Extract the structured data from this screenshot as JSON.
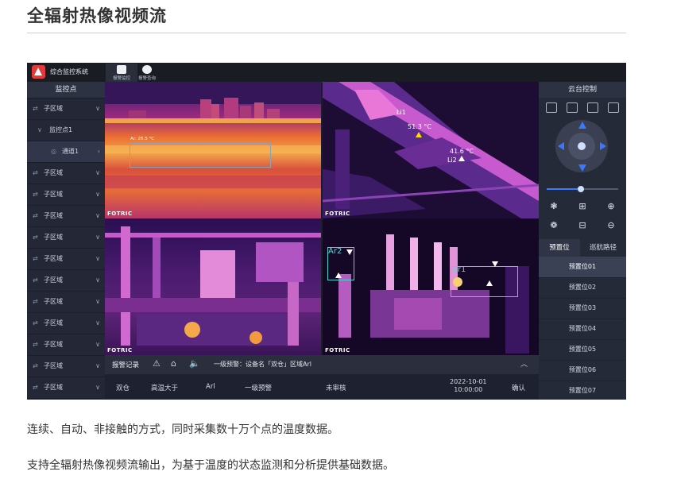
{
  "page": {
    "title": "全辐射热像视频流",
    "description_1": "连续、自动、非接触的方式，同时采集数十万个点的温度数据。",
    "description_2": "支持全辐射热像视频流输出，为基于温度的状态监测和分析提供基础数据。"
  },
  "app": {
    "system_name": "综合监控系统",
    "nav": [
      {
        "label": "报警监控"
      },
      {
        "label": "报警查询"
      }
    ]
  },
  "sidebar": {
    "header": "监控点",
    "rows": [
      {
        "label": "子区域",
        "type": "region"
      },
      {
        "label": "监控点1",
        "type": "point"
      },
      {
        "label": "通道1",
        "type": "channel"
      },
      {
        "label": "子区域",
        "type": "region"
      },
      {
        "label": "子区域",
        "type": "region"
      },
      {
        "label": "子区域",
        "type": "region"
      },
      {
        "label": "子区域",
        "type": "region"
      },
      {
        "label": "子区域",
        "type": "region"
      },
      {
        "label": "子区域",
        "type": "region"
      },
      {
        "label": "子区域",
        "type": "region"
      },
      {
        "label": "子区域",
        "type": "region"
      },
      {
        "label": "子区域",
        "type": "region"
      },
      {
        "label": "子区域",
        "type": "region"
      },
      {
        "label": "子区域",
        "type": "region"
      },
      {
        "label": "子区域",
        "type": "region"
      }
    ]
  },
  "videos": {
    "brand": "FOTRIC",
    "v1": {
      "roi_label": "Ar: 26.5 °C"
    },
    "v2": {
      "li1_label": "Li1",
      "li1_temp": "51.3 °C",
      "li2_label": "Li2",
      "li2_temp": "41.6 °C"
    },
    "v4": {
      "ar2_label": "Ar2",
      "ar1_label": "Ar1"
    }
  },
  "alarm": {
    "title": "报警记录",
    "message": "一级预警：设备名「双仓」区域Arl",
    "record": {
      "device": "双仓",
      "condition": "高温大于",
      "area": "Arl",
      "level": "一级预警",
      "status": "未审核",
      "date": "2022-10-01",
      "time": "10:00:00",
      "action": "确认"
    }
  },
  "ptz": {
    "title": "云台控制",
    "zoom_level": 0.48,
    "tabs": [
      {
        "label": "预置位",
        "active": true
      },
      {
        "label": "巡航路径",
        "active": false
      }
    ],
    "presets": [
      "预置位01",
      "预置位02",
      "预置位03",
      "预置位04",
      "预置位05",
      "预置位06",
      "预置位07"
    ]
  },
  "colors": {
    "accent": "#3a78ff",
    "cyan_roi": "#4fd5d0",
    "logo_red": "#e23a3a"
  }
}
